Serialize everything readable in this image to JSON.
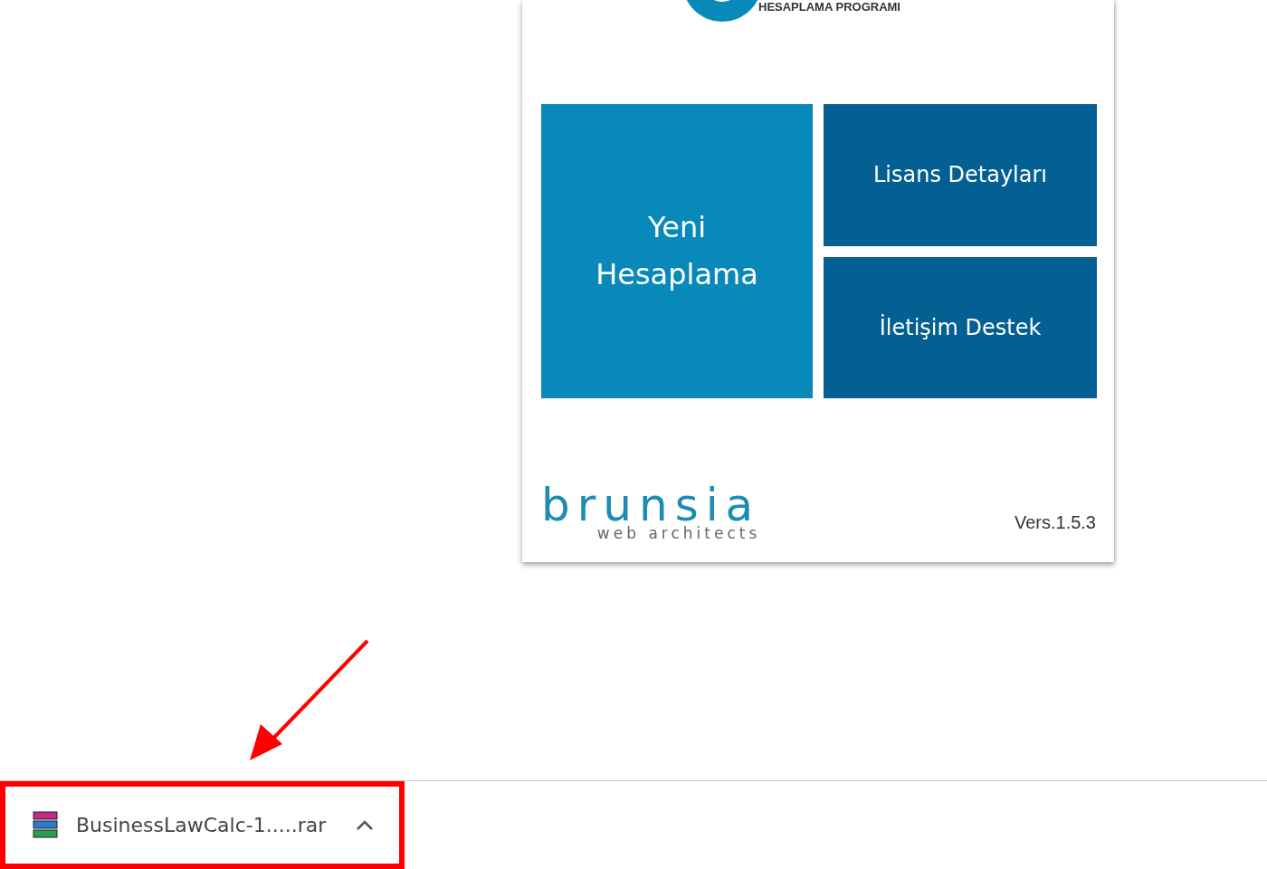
{
  "app_window": {
    "heading": "HESAPLAMA PROGRAMI",
    "tiles": [
      {
        "label": "Yeni Hesaplama",
        "kind": "large"
      },
      {
        "label": "Lisans Detayları",
        "kind": "small"
      },
      {
        "label": "İletişim Destek",
        "kind": "small"
      }
    ],
    "brand": {
      "name": "brunsia",
      "tagline": "web architects"
    },
    "version": "Vers.1.5.3"
  },
  "download_bar": {
    "items": [
      {
        "file_name": "BusinessLawCalc-1.....rar",
        "highlighted": true
      }
    ]
  }
}
